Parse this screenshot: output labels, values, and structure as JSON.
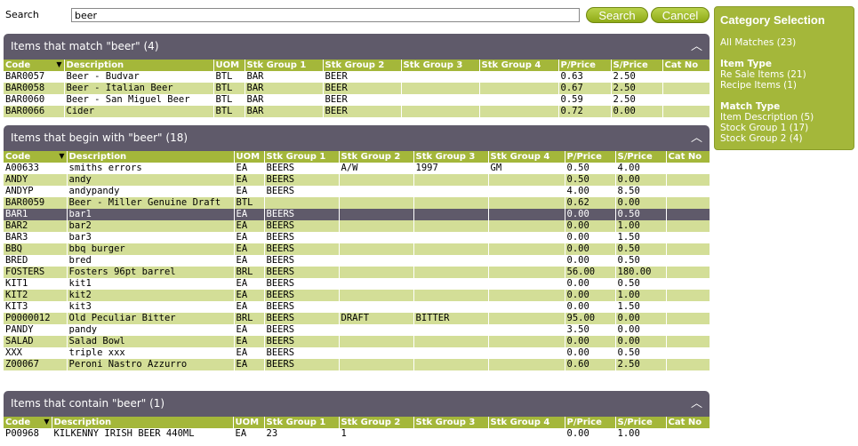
{
  "search": {
    "label": "Search",
    "value": "beer",
    "search_button": "Search",
    "cancel_button": "Cancel"
  },
  "sidebar": {
    "title": "Category Selection",
    "all_matches": "All Matches (23)",
    "item_type_title": "Item Type",
    "item_type": [
      "Re Sale Items (21)",
      "Recipe Items (1)"
    ],
    "match_type_title": "Match Type",
    "match_type": [
      "Item Description (5)",
      "Stock Group 1 (17)",
      "Stock Group 2 (4)"
    ]
  },
  "columns": [
    "Code",
    "Description",
    "UOM",
    "Stk Group 1",
    "Stk Group 2",
    "Stk Group 3",
    "Stk Group 4",
    "P/Price",
    "S/Price",
    "Cat No"
  ],
  "sections": [
    {
      "title": "Items that match \"beer\" (4)",
      "rows": [
        [
          "BAR0057",
          "Beer - Budvar",
          "BTL",
          "BAR",
          "BEER",
          "",
          "",
          "0.63",
          "2.50",
          ""
        ],
        [
          "BAR0058",
          "Beer - Italian Beer",
          "BTL",
          "BAR",
          "BEER",
          "",
          "",
          "0.67",
          "2.50",
          ""
        ],
        [
          "BAR0060",
          "Beer - San Miguel Beer",
          "BTL",
          "BAR",
          "BEER",
          "",
          "",
          "0.59",
          "2.50",
          ""
        ],
        [
          "BAR0066",
          "Cider",
          "BTL",
          "BAR",
          "BEER",
          "",
          "",
          "0.72",
          "0.00",
          ""
        ]
      ]
    },
    {
      "title": "Items that begin with \"beer\" (18)",
      "rows": [
        [
          "A00633",
          "smiths errors",
          "EA",
          "BEERS",
          "A/W",
          "1997",
          "GM",
          "0.50",
          "4.00",
          ""
        ],
        [
          "ANDY",
          "andy",
          "EA",
          "BEERS",
          "",
          "",
          "",
          "0.50",
          "0.00",
          ""
        ],
        [
          "ANDYP",
          "andypandy",
          "EA",
          "BEERS",
          "",
          "",
          "",
          "4.00",
          "8.50",
          ""
        ],
        [
          "BAR0059",
          "Beer - Miller Genuine Draft",
          "BTL",
          "",
          "",
          "",
          "",
          "0.62",
          "0.00",
          ""
        ],
        [
          "BAR1",
          "bar1",
          "EA",
          "BEERS",
          "",
          "",
          "",
          "0.00",
          "0.50",
          ""
        ],
        [
          "BAR2",
          "bar2",
          "EA",
          "BEERS",
          "",
          "",
          "",
          "0.00",
          "1.00",
          ""
        ],
        [
          "BAR3",
          "bar3",
          "EA",
          "BEERS",
          "",
          "",
          "",
          "0.00",
          "1.50",
          ""
        ],
        [
          "BBQ",
          "bbq burger",
          "EA",
          "BEERS",
          "",
          "",
          "",
          "0.00",
          "0.50",
          ""
        ],
        [
          "BRED",
          "bred",
          "EA",
          "BEERS",
          "",
          "",
          "",
          "0.00",
          "0.50",
          ""
        ],
        [
          "FOSTERS",
          "Fosters 96pt barrel",
          "BRL",
          "BEERS",
          "",
          "",
          "",
          "56.00",
          "180.00",
          ""
        ],
        [
          "KIT1",
          "kit1",
          "EA",
          "BEERS",
          "",
          "",
          "",
          "0.00",
          "0.50",
          ""
        ],
        [
          "KIT2",
          "kit2",
          "EA",
          "BEERS",
          "",
          "",
          "",
          "0.00",
          "1.00",
          ""
        ],
        [
          "KIT3",
          "kit3",
          "EA",
          "BEERS",
          "",
          "",
          "",
          "0.00",
          "1.50",
          ""
        ],
        [
          "P0000012",
          "Old Peculiar Bitter",
          "BRL",
          "BEERS",
          "DRAFT",
          "BITTER",
          "",
          "95.00",
          "0.00",
          ""
        ],
        [
          "PANDY",
          "pandy",
          "EA",
          "BEERS",
          "",
          "",
          "",
          "3.50",
          "0.00",
          ""
        ],
        [
          "SALAD",
          "Salad Bowl",
          "EA",
          "BEERS",
          "",
          "",
          "",
          "0.00",
          "0.00",
          ""
        ],
        [
          "XXX",
          "triple xxx",
          "EA",
          "BEERS",
          "",
          "",
          "",
          "0.00",
          "0.50",
          ""
        ],
        [
          "Z00067",
          "Peroni Nastro Azzurro",
          "EA",
          "BEERS",
          "",
          "",
          "",
          "0.60",
          "2.50",
          ""
        ]
      ],
      "selected_row": 4
    },
    {
      "title": "Items that contain \"beer\" (1)",
      "rows": [
        [
          "P00968",
          "KILKENNY IRISH BEER 440ML",
          "EA",
          "23",
          "1",
          "",
          "",
          "0.00",
          "1.00",
          ""
        ]
      ]
    }
  ],
  "icons": {
    "collapse": "chevron-up-icon",
    "sort": "sort-desc-icon"
  },
  "colors": {
    "accent": "#a4b73a",
    "alt_row": "#d3de97",
    "header": "#5f5a6a"
  }
}
